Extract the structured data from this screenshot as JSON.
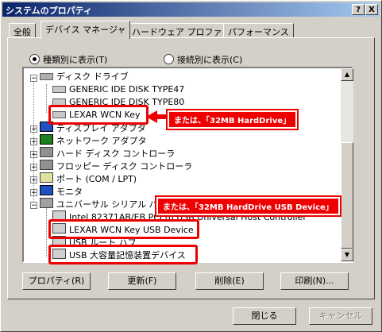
{
  "window": {
    "title": "システムのプロパティ",
    "help_btn": "?",
    "close_btn": "X"
  },
  "tabs": [
    "全般",
    "デバイス マネージャ",
    "ハードウェア プロファイル",
    "パフォーマンス"
  ],
  "view": {
    "by_type": "種類別に表示(T)",
    "by_connection": "接続別に表示(C)",
    "selected": "by_type"
  },
  "tree": {
    "disk_drives": "ディスク ドライブ",
    "disk1": "GENERIC IDE DISK TYPE47",
    "disk2": "GENERIC IDE DISK TYPE80",
    "lexar_disk": "LEXAR WCN Key",
    "display": "ディスプレイ アダプタ",
    "network": "ネットワーク アダプタ",
    "hdd_ctrl": "ハード ディスク コントローラ",
    "fdd_ctrl": "フロッピー ディスク コントローラ",
    "ports": "ポート (COM / LPT)",
    "monitor": "モニタ",
    "usb": "ユニバーサル シリアル バス",
    "usb_host": "Intel 82371AB/EB PCI to USB Universal Host Controller",
    "lexar_usb": "LEXAR WCN Key USB Device",
    "usb_hub": "USB ルート ハブ",
    "mass_storage": "USB 大容量記憶装置デバイス"
  },
  "annotations": {
    "note1": "または、「32MB HardDrive」",
    "note2": "または、「32MB HardDrive USB Device」"
  },
  "buttons": {
    "properties": "プロパティ(R)",
    "refresh": "更新(F)",
    "remove": "削除(E)",
    "print": "印刷(N)...",
    "close": "閉じる",
    "cancel": "キャンセル"
  },
  "scrollbar": {
    "up": "▲",
    "down": "▼"
  }
}
